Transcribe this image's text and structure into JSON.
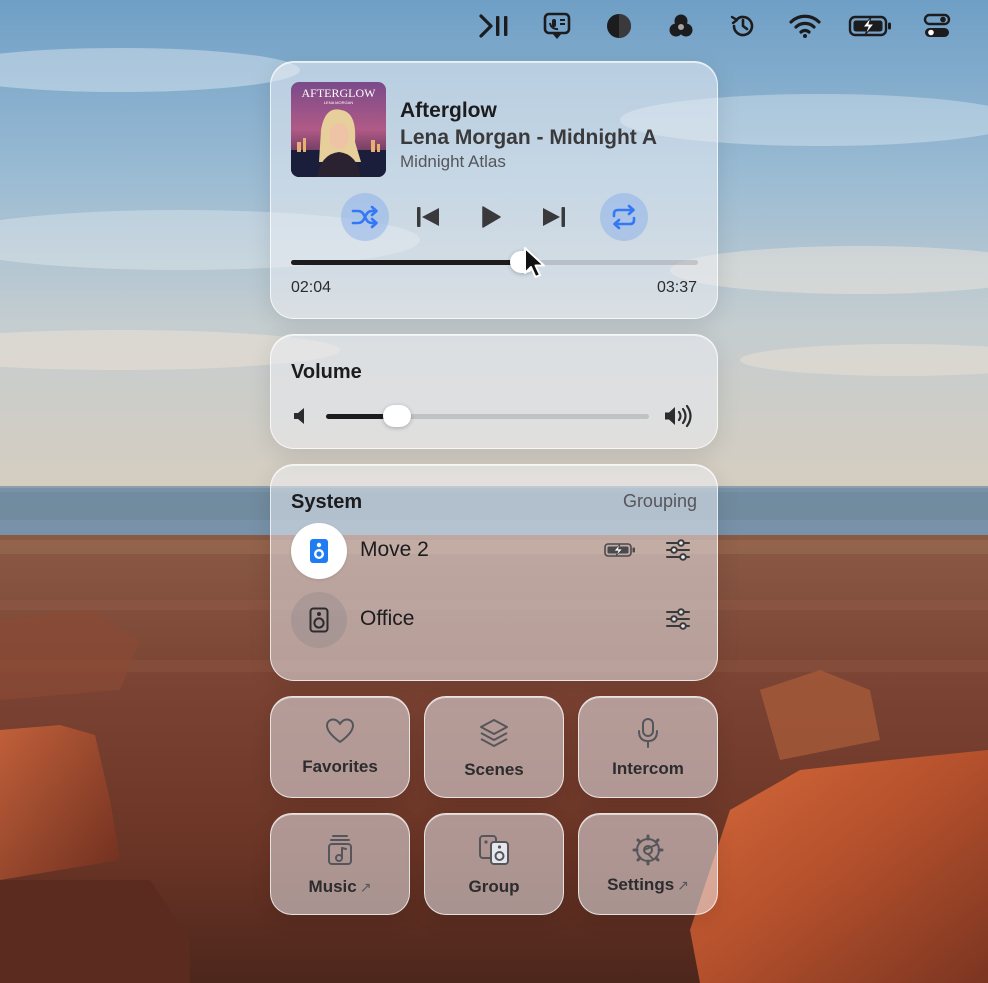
{
  "menubar": {
    "icons": [
      "play-pause-icon",
      "transcript-icon",
      "dark-circle-icon",
      "color-circles-icon",
      "time-machine-icon",
      "wifi-icon",
      "battery-charging-icon",
      "control-center-icon"
    ]
  },
  "now_playing": {
    "album_art_text": "AFTERGLOW",
    "album_art_subtext": "LENA MORGAN",
    "title": "Afterglow",
    "artist_line": "Lena Morgan - Midnight A",
    "album": "Midnight Atlas",
    "shuffle_on": true,
    "repeat_on": true,
    "progress_fraction": 0.57,
    "elapsed": "02:04",
    "duration": "03:37"
  },
  "volume": {
    "heading": "Volume",
    "level_fraction": 0.22
  },
  "system": {
    "heading": "System",
    "grouping_label": "Grouping",
    "devices": [
      {
        "name": "Move 2",
        "active": true,
        "battery": "charging"
      },
      {
        "name": "Office",
        "active": false
      }
    ]
  },
  "tiles": {
    "favorites": "Favorites",
    "scenes": "Scenes",
    "intercom": "Intercom",
    "music": "Music",
    "group": "Group",
    "settings": "Settings",
    "external_glyph": "↗"
  },
  "colors": {
    "accent_active": "#3478f6",
    "speaker_blue": "#1f7cf2",
    "panel_glass": "rgba(238,240,245,0.52)",
    "text_primary": "#1c1c1e"
  }
}
